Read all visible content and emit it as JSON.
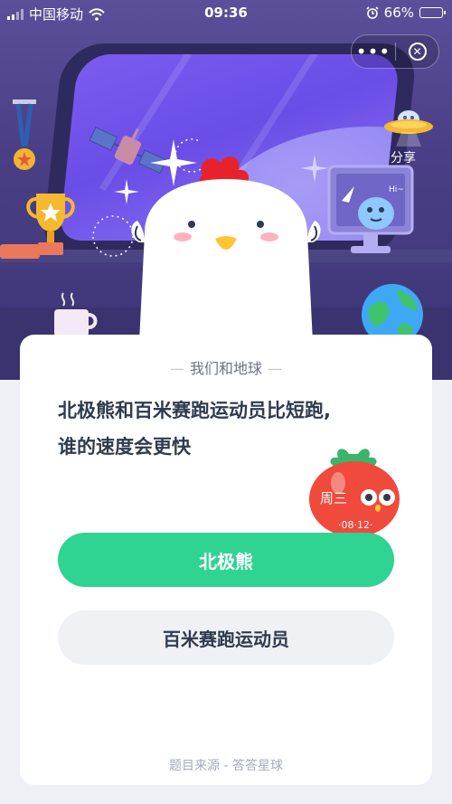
{
  "status_bar": {
    "carrier": "中国移动",
    "time": "09:36",
    "battery": "66%",
    "battery_level": 0.66
  },
  "capsule": {
    "more_label": "•••",
    "close_label": "✕"
  },
  "scene": {
    "share_label": "分享",
    "tomato_text": "周三",
    "tomato_date": "·08·12·",
    "alien_text": "Hi~"
  },
  "card": {
    "topic": "我们和地球",
    "question_line1": "北极熊和百米赛跑运动员比短跑,",
    "question_line2": "谁的速度会更快",
    "options": [
      {
        "label": "北极熊"
      },
      {
        "label": "百米赛跑运动员"
      }
    ],
    "source": "题目来源 - 答答星球"
  },
  "colors": {
    "accent": "#2fd392",
    "scene_bg": "#4a3f86",
    "question_text": "#2f3b4e"
  }
}
